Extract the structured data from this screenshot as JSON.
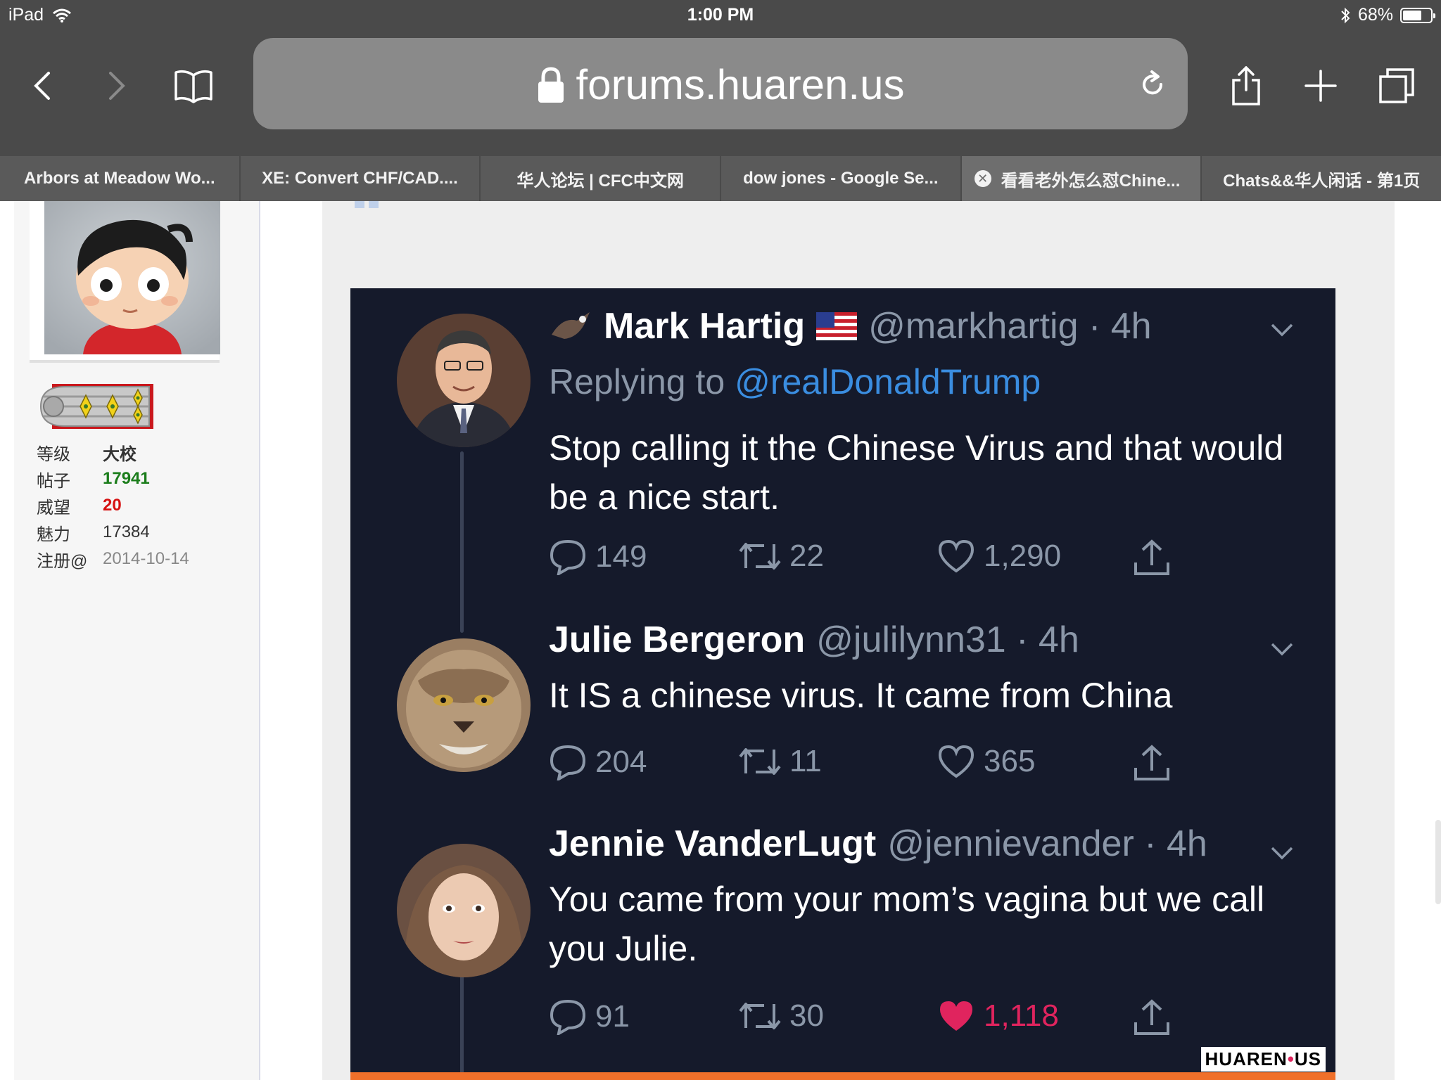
{
  "status_bar": {
    "device": "iPad",
    "time": "1:00 PM",
    "battery": "68%"
  },
  "browser": {
    "url": "forums.huaren.us",
    "tabs": [
      {
        "label": "Arbors at Meadow Wo..."
      },
      {
        "label": "XE: Convert CHF/CAD...."
      },
      {
        "label": "华人论坛 | CFC中文网"
      },
      {
        "label": "dow jones - Google Se..."
      },
      {
        "label": "看看老外怎么怼Chine...",
        "active": true
      },
      {
        "label": "Chats&&华人闲话 - 第1页"
      }
    ],
    "icons": [
      "back-icon",
      "forward-icon",
      "bookmarks-icon",
      "lock-icon",
      "reload-icon",
      "share-icon",
      "new-tab-icon",
      "tabs-icon"
    ]
  },
  "profile": {
    "stats": [
      {
        "key": "等级",
        "value": "大校",
        "style": "plain-bold"
      },
      {
        "key": "帖子",
        "value": "17941",
        "style": "green"
      },
      {
        "key": "威望",
        "value": "20",
        "style": "red"
      },
      {
        "key": "魅力",
        "value": "17384",
        "style": "plain"
      },
      {
        "key": "注册@",
        "value": "2014-10-14",
        "style": "gray"
      }
    ]
  },
  "tweets": [
    {
      "name": "Mark Hartig",
      "handle": "@markhartig · 4h",
      "reply_prefix": "Replying to",
      "reply_to": "@realDonaldTrump",
      "text": "Stop calling it the Chinese Virus and that would be a nice start.",
      "replies": "149",
      "retweets": "22",
      "likes": "1,290",
      "liked": false
    },
    {
      "name": "Julie Bergeron",
      "handle": "@julilynn31 · 4h",
      "text": "It IS a chinese virus. It came from China",
      "replies": "204",
      "retweets": "11",
      "likes": "365",
      "liked": false
    },
    {
      "name": "Jennie VanderLugt",
      "handle": "@jennievander · 4h",
      "text": "You came from your mom’s vagina but we call you Julie.",
      "replies": "91",
      "retweets": "30",
      "likes": "1,118",
      "liked": true
    }
  ],
  "watermark": {
    "left": "HUAREN",
    "dot": "•",
    "right": "US"
  },
  "colors": {
    "chrome": "#4a4a4a",
    "tweet_bg": "#151a2b",
    "handle_gray": "#8b97a8",
    "mention_blue": "#3a8de0",
    "like_red": "#e0245e",
    "orange_bar": "#f0702a"
  }
}
